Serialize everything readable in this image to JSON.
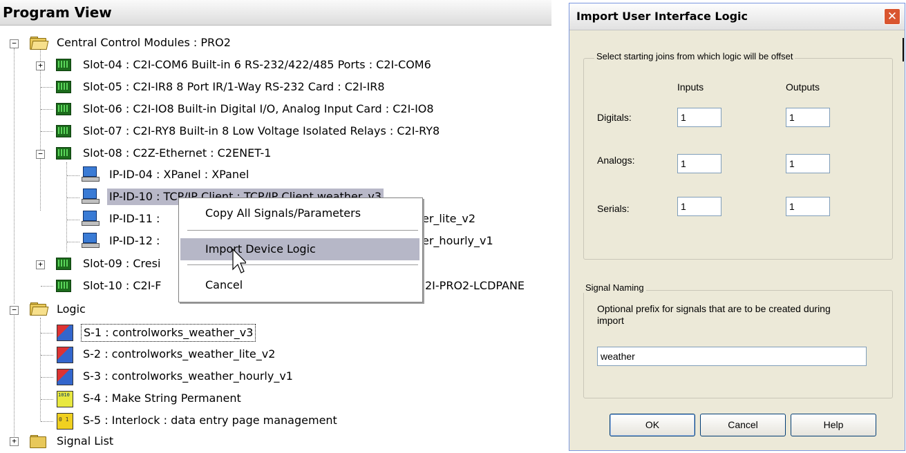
{
  "program_view": {
    "title": "Program View",
    "tree": {
      "central": "Central Control Modules : PRO2",
      "slot04": "Slot-04 : C2I-COM6 Built-in 6 RS-232/422/485 Ports : C2I-COM6",
      "slot05": "Slot-05 : C2I-IR8 8 Port IR/1-Way RS-232 Card : C2I-IR8",
      "slot06": "Slot-06 : C2I-IO8 Built-in Digital I/O, Analog Input Card : C2I-IO8",
      "slot07": "Slot-07 : C2I-RY8 Built-in 8 Low Voltage Isolated Relays : C2I-RY8",
      "slot08": "Slot-08 : C2Z-Ethernet : C2ENET-1",
      "ip04": "IP-ID-04 : XPanel : XPanel",
      "ip10": "IP-ID-10 : TCP/IP Client : TCP/IP Client weather_v3",
      "ip11_left": "IP-ID-11 :",
      "ip11_right": "er_lite_v2",
      "ip12_left": "IP-ID-12 :",
      "ip12_right": "er_hourly_v1",
      "slot09": "Slot-09 : Cresi",
      "slot10_left": "Slot-10 : C2I-F",
      "slot10_right": "2I-PRO2-LCDPANE",
      "logic": "Logic",
      "s1": "S-1 : controlworks_weather_v3",
      "s2": "S-2 : controlworks_weather_lite_v2",
      "s3": "S-3 : controlworks_weather_hourly_v1",
      "s4": "S-4 : Make String Permanent",
      "s5": "S-5 : Interlock : data entry page management",
      "signal_list": "Signal List"
    },
    "context_menu": {
      "copy": "Copy All Signals/Parameters",
      "import": "Import Device Logic",
      "cancel": "Cancel"
    }
  },
  "dialog": {
    "title": "Import User Interface Logic",
    "joins_group": "Select starting joins from which logic will be offset",
    "inputs_header": "Inputs",
    "outputs_header": "Outputs",
    "rows": [
      {
        "label": "Digitals:",
        "input": "1",
        "output": "1"
      },
      {
        "label": "Analogs:",
        "input": "1",
        "output": "1"
      },
      {
        "label": "Serials:",
        "input": "1",
        "output": "1"
      }
    ],
    "naming_group": "Signal Naming",
    "naming_desc": "Optional prefix for signals that are to be created during import",
    "prefix_value": "weather",
    "buttons": {
      "ok": "OK",
      "cancel": "Cancel",
      "help": "Help"
    }
  }
}
